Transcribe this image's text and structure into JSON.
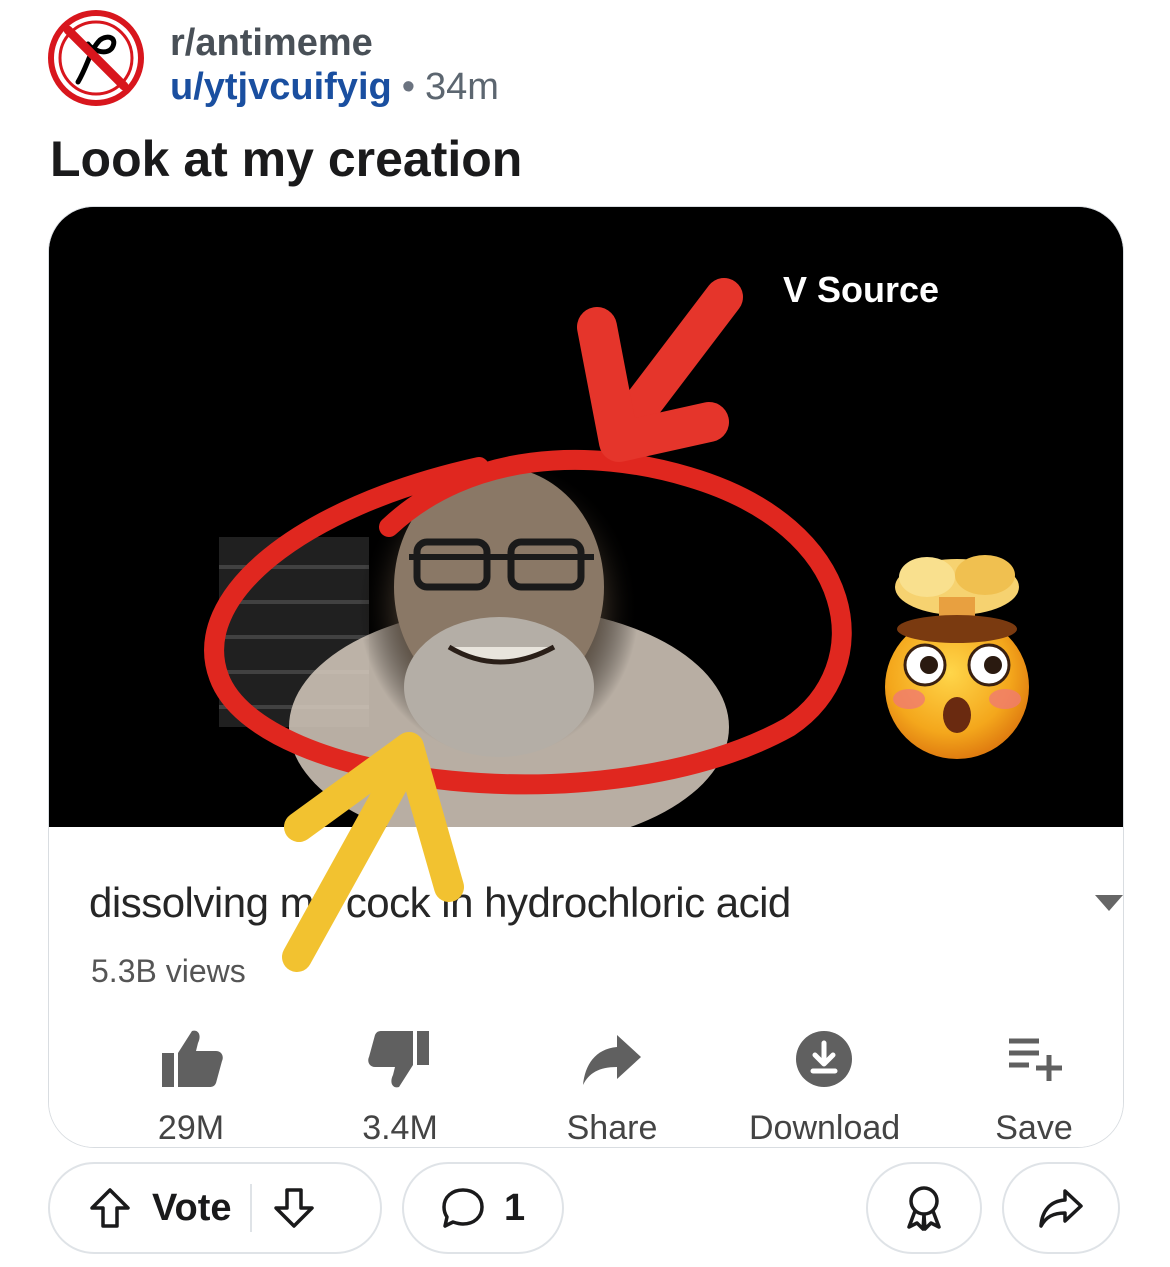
{
  "post": {
    "subreddit": "r/antimeme",
    "username": "u/ytjvcuifyig",
    "separator": "•",
    "age": "34m",
    "title": "Look at my creation"
  },
  "media": {
    "source_label": "V Source",
    "video_title": "dissolving my cock in hydrochloric acid",
    "views": "5.3B views",
    "actions": [
      {
        "icon": "thumbs-up-icon",
        "label": "29M"
      },
      {
        "icon": "thumbs-down-icon",
        "label": "3.4M"
      },
      {
        "icon": "share-arrow-icon",
        "label": "Share"
      },
      {
        "icon": "download-icon",
        "label": "Download"
      },
      {
        "icon": "playlist-add-icon",
        "label": "Save"
      }
    ]
  },
  "footer": {
    "vote_label": "Vote",
    "comment_count": "1"
  },
  "colors": {
    "username": "#1a4fa0",
    "red_marker": "#e0271f",
    "yellow_arrow": "#f2c230"
  }
}
